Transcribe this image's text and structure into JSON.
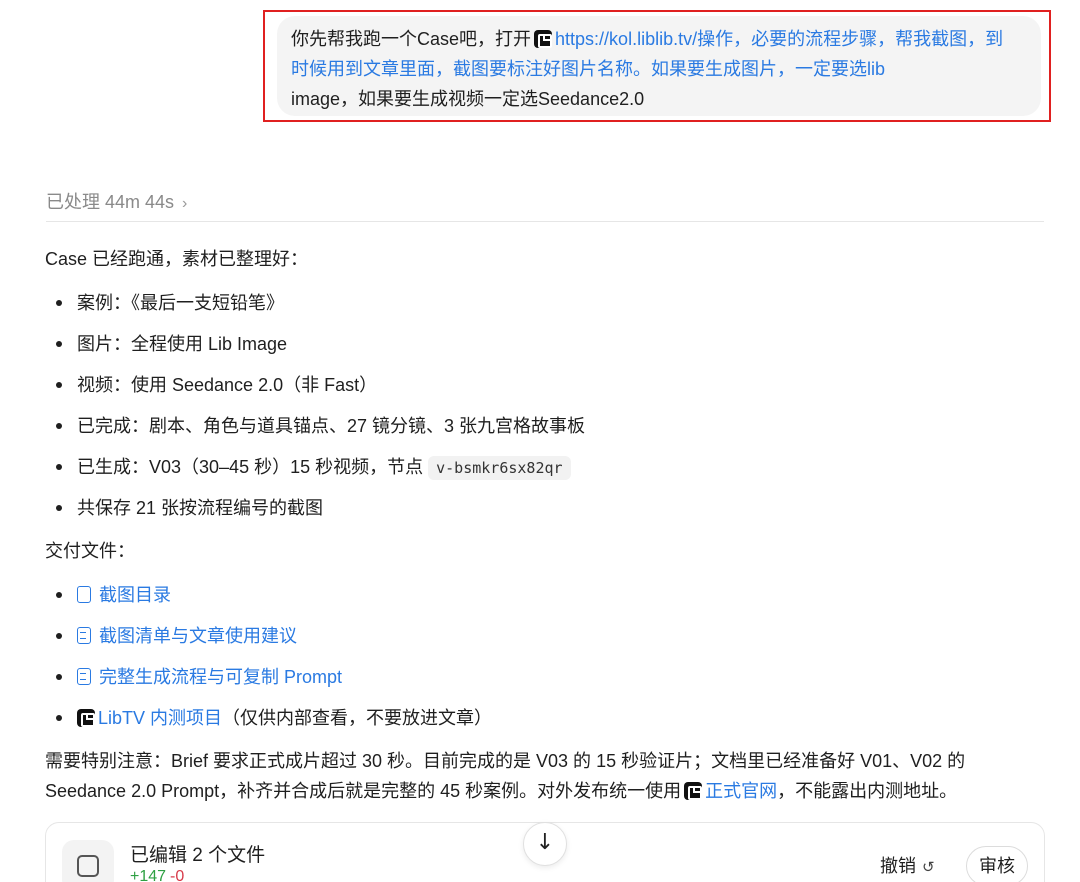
{
  "user_message": {
    "prefix": "你先帮我跑一个Case吧，打开",
    "app_icon": "libtv-app-icon",
    "link_text": "https://kol.liblib.tv/操作，必要的流程步骤，帮我截图，到时候用到文章里面，截图要标注好图片名称。如果要生成图片，一定要选lib",
    "suffix": "image，如果要生成视频一定选Seedance2.0"
  },
  "processed": {
    "label": "已处理 44m 44s",
    "chevron": "›"
  },
  "summary_intro": "Case 已经跑通，素材已整理好：",
  "summary_items": [
    {
      "label": "案例：",
      "value": "《最后一支短铅笔》"
    },
    {
      "label": "图片：",
      "value": "全程使用 Lib Image"
    },
    {
      "label": "视频：",
      "value": "使用 Seedance 2.0（非 Fast）"
    },
    {
      "label": "已完成：",
      "value": "剧本、角色与道具锚点、27 镜分镜、3 张九宫格故事板"
    },
    {
      "label": "已生成：",
      "value": "V03（30–45 秒）15 秒视频，节点",
      "code": "v-bsmkr6sx82qr"
    },
    {
      "label": "",
      "value": "共保存 21 张按流程编号的截图"
    }
  ],
  "deliverables_title": "交付文件：",
  "deliverables": [
    {
      "icon": "document-icon",
      "text": "截图目录"
    },
    {
      "icon": "document-lines-icon",
      "text": "截图清单与文章使用建议"
    },
    {
      "icon": "document-lines-icon",
      "text": "完整生成流程与可复制 Prompt"
    },
    {
      "icon": "libtv-app-icon",
      "text": "LibTV 内测项目",
      "note": "（仅供内部查看，不要放进文章）"
    }
  ],
  "note": {
    "part1": "需要特别注意：Brief 要求正式成片超过 30 秒。目前完成的是 V03 的 15 秒验证片；文档里已经准备好 V01、V02 的 Seedance 2.0 Prompt，补齐并合成后就是完整的 45 秒案例。对外发布统一使用",
    "link": "正式官网",
    "part2": "，不能露出内测地址。"
  },
  "edit_card": {
    "title": "已编辑 2 个文件",
    "added": "+147",
    "removed": "-0",
    "undo_label": "撤销",
    "undo_icon": "↺",
    "review_label": "审核"
  },
  "scroll_down_icon": "↓",
  "colors": {
    "link": "#2a7ae2",
    "highlight_frame": "#e02020",
    "added": "#2ea043",
    "removed": "#d73a49"
  }
}
